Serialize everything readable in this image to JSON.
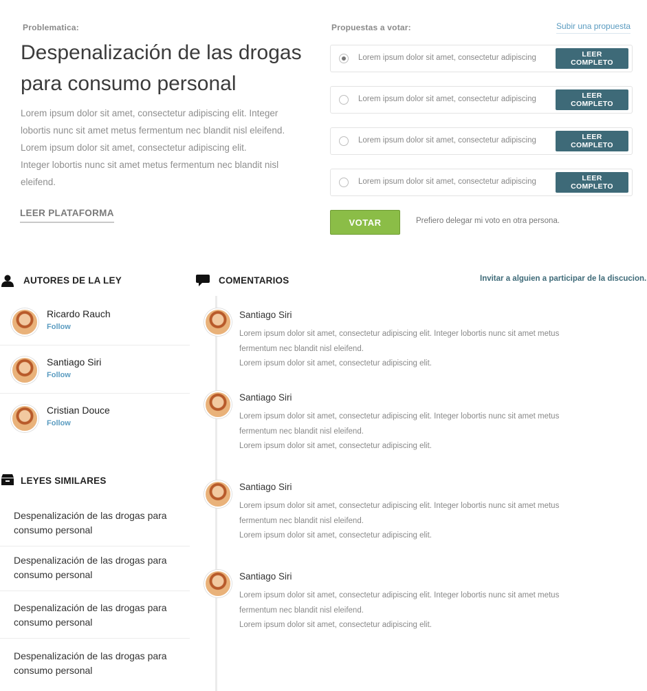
{
  "problem": {
    "label": "Problematica:",
    "title": "Despenalización de las drogas para consumo personal",
    "text_line1": "Lorem ipsum dolor sit amet, consectetur adipiscing elit. Integer",
    "text_line2": "lobortis nunc sit amet metus fermentum nec blandit nisl eleifend.",
    "text_line3": "Lorem ipsum dolor sit amet, consectetur adipiscing elit.",
    "text_line4": "Integer lobortis nunc sit amet metus fermentum nec blandit nisl",
    "text_line5": "eleifend.",
    "platform_link": "LEER PLATAFORMA"
  },
  "proposals": {
    "label": "Propuestas a votar:",
    "submit_link": "Subir una propuesta",
    "items": [
      {
        "text": "Lorem ipsum dolor sit amet, consectetur adipiscing",
        "button": "LEER COMPLETO",
        "selected": true
      },
      {
        "text": "Lorem ipsum dolor sit amet, consectetur adipiscing",
        "button": "LEER COMPLETO",
        "selected": false
      },
      {
        "text": "Lorem ipsum dolor sit amet, consectetur adipiscing",
        "button": "LEER COMPLETO",
        "selected": false
      },
      {
        "text": "Lorem ipsum dolor sit amet, consectetur adipiscing",
        "button": "LEER COMPLETO",
        "selected": false
      }
    ],
    "vote_button": "VOTAR",
    "delegate_link": "Prefiero delegar mi voto en otra persona."
  },
  "authors": {
    "heading": "AUTORES DE LA LEY",
    "items": [
      {
        "name": "Ricardo Rauch",
        "follow": "Follow"
      },
      {
        "name": "Santiago Siri",
        "follow": "Follow"
      },
      {
        "name": "Cristian Douce",
        "follow": "Follow"
      }
    ]
  },
  "similar": {
    "heading": "LEYES SIMILARES",
    "items": [
      {
        "line1": "Despenalización de las drogas para",
        "line2": "consumo personal"
      },
      {
        "line1": "Despenalización de las drogas para",
        "line2": "consumo personal"
      },
      {
        "line1": "Despenalización de las drogas para",
        "line2": "consumo personal"
      },
      {
        "line1": "Despenalización de las drogas para",
        "line2": "consumo personal"
      }
    ]
  },
  "comments": {
    "heading": "COMENTARIOS",
    "invite_link": "Invitar a alguien a participar de la discucion.",
    "items": [
      {
        "author": "Santiago Siri",
        "line1": "Lorem ipsum dolor sit amet, consectetur adipiscing elit. Integer lobortis nunc sit amet metus",
        "line2": "fermentum nec blandit nisl eleifend.",
        "line3": "Lorem ipsum dolor sit amet, consectetur adipiscing elit."
      },
      {
        "author": "Santiago Siri",
        "line1": "Lorem ipsum dolor sit amet, consectetur adipiscing elit. Integer lobortis nunc sit amet metus",
        "line2": "fermentum nec blandit nisl eleifend.",
        "line3": "Lorem ipsum dolor sit amet, consectetur adipiscing elit."
      },
      {
        "author": "Santiago Siri",
        "line1": "Lorem ipsum dolor sit amet, consectetur adipiscing elit. Integer lobortis nunc sit amet metus",
        "line2": "fermentum nec blandit nisl eleifend.",
        "line3": "Lorem ipsum dolor sit amet, consectetur adipiscing elit."
      },
      {
        "author": "Santiago Siri",
        "line1": "Lorem ipsum dolor sit amet, consectetur adipiscing elit. Integer lobortis nunc sit amet metus",
        "line2": "fermentum nec blandit nisl eleifend.",
        "line3": "Lorem ipsum dolor sit amet, consectetur adipiscing elit."
      }
    ]
  },
  "colors": {
    "accent_teal": "#3e6a78",
    "vote_green": "#8bbd47",
    "link_blue": "#5a9bc0"
  },
  "icons": {
    "authors": "user-icon",
    "comments": "speech-bubble-icon",
    "similar": "archive-box-icon"
  }
}
